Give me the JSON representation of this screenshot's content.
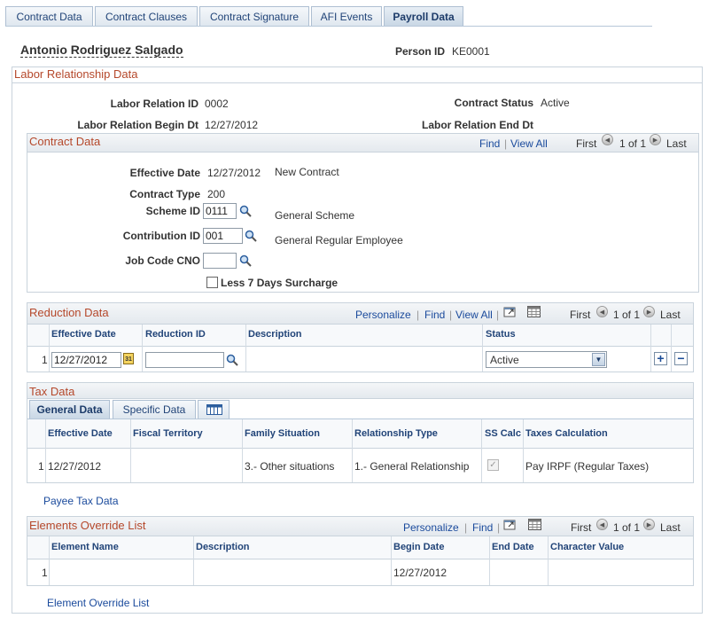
{
  "tabs": [
    {
      "label": "Contract Data"
    },
    {
      "label": "Contract Clauses"
    },
    {
      "label": "Contract Signature"
    },
    {
      "label": "AFI Events"
    },
    {
      "label": "Payroll Data"
    }
  ],
  "person": {
    "name": "Antonio Rodriguez Salgado",
    "id_label": "Person ID",
    "id_value": "KE0001"
  },
  "labor": {
    "title": "Labor Relationship Data",
    "relation_id_label": "Labor Relation ID",
    "relation_id": "0002",
    "status_label": "Contract Status",
    "status": "Active",
    "begin_label": "Labor Relation Begin Dt",
    "begin": "12/27/2012",
    "end_label": "Labor Relation End Dt"
  },
  "contract": {
    "title": "Contract Data",
    "find": "Find",
    "view_all": "View All",
    "first": "First",
    "page": "1 of 1",
    "last": "Last",
    "eff_date_label": "Effective Date",
    "eff_date": "12/27/2012",
    "eff_desc": "New Contract",
    "type_label": "Contract Type",
    "type": "200",
    "scheme_label": "Scheme ID",
    "scheme": "0111",
    "scheme_desc": "General Scheme",
    "contrib_label": "Contribution ID",
    "contrib": "001",
    "contrib_desc": "General Regular Employee",
    "jobcode_label": "Job Code CNO",
    "jobcode": "",
    "surcharge_label": "Less 7 Days Surcharge"
  },
  "reduction": {
    "title": "Reduction Data",
    "personalize": "Personalize",
    "find": "Find",
    "view_all": "View All",
    "first": "First",
    "page": "1 of 1",
    "last": "Last",
    "cols": [
      "Effective Date",
      "Reduction ID",
      "Description",
      "Status"
    ],
    "row": {
      "num": "1",
      "eff_date": "12/27/2012",
      "reduction_id": "",
      "status": "Active"
    }
  },
  "tax": {
    "title": "Tax Data",
    "tab_general": "General Data",
    "tab_specific": "Specific Data",
    "cols": [
      "Effective Date",
      "Fiscal Territory",
      "Family Situation",
      "Relationship Type",
      "SS Calc",
      "Taxes Calculation"
    ],
    "row": {
      "num": "1",
      "eff_date": "12/27/2012",
      "fiscal": "",
      "family": "3.- Other situations",
      "relationship": "1.- General Relationship",
      "taxes": "Pay IRPF (Regular Taxes)"
    }
  },
  "payee_link": "Payee Tax Data",
  "elements": {
    "title": "Elements Override List",
    "personalize": "Personalize",
    "find": "Find",
    "first": "First",
    "page": "1 of 1",
    "last": "Last",
    "cols": [
      "Element Name",
      "Description",
      "Begin Date",
      "End Date",
      "Character Value"
    ],
    "row": {
      "num": "1",
      "begin": "12/27/2012"
    }
  },
  "element_link": "Element Override List"
}
